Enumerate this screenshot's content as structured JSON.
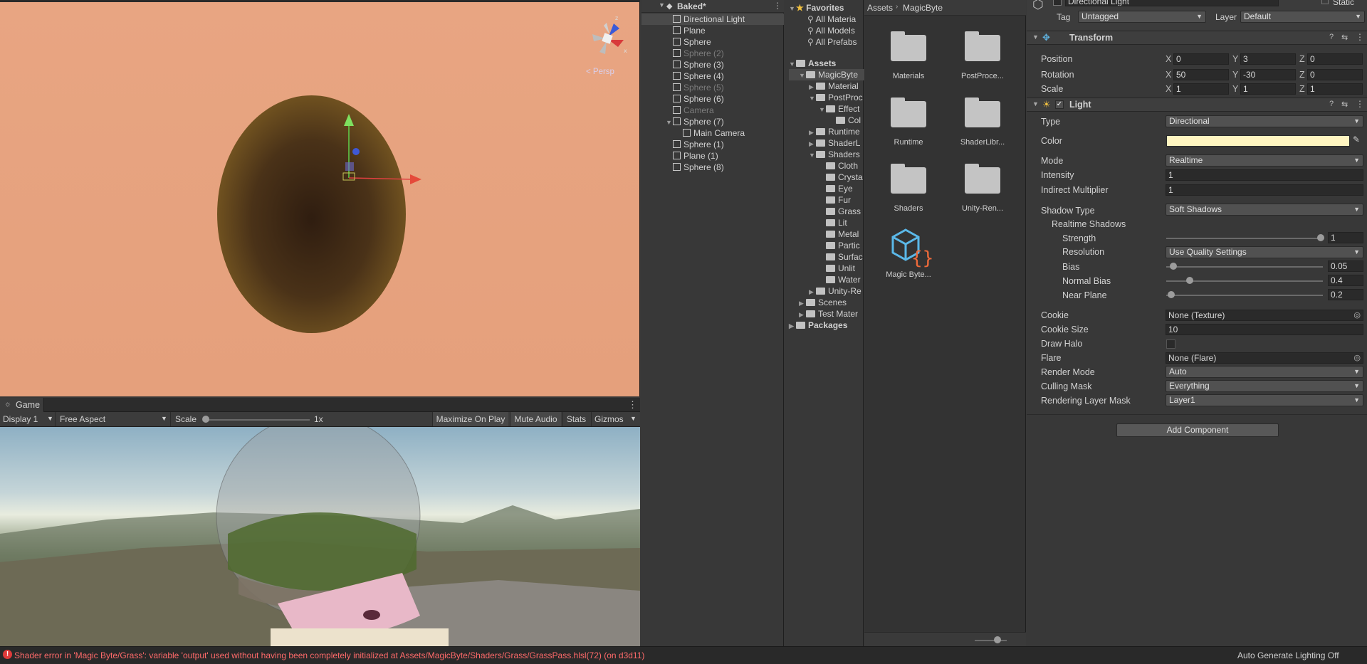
{
  "scene": {
    "persp_label": "< Persp"
  },
  "game": {
    "tab_label": "Game",
    "display": "Display 1",
    "aspect": "Free Aspect",
    "scale_label": "Scale",
    "scale_value": "1x",
    "maximize": "Maximize On Play",
    "mute": "Mute Audio",
    "stats": "Stats",
    "gizmos": "Gizmos"
  },
  "hierarchy": {
    "scene_name": "Baked*",
    "items": [
      {
        "label": "Directional Light",
        "dim": false
      },
      {
        "label": "Plane",
        "dim": false
      },
      {
        "label": "Sphere",
        "dim": false
      },
      {
        "label": "Sphere (2)",
        "dim": true
      },
      {
        "label": "Sphere (3)",
        "dim": false
      },
      {
        "label": "Sphere (4)",
        "dim": false
      },
      {
        "label": "Sphere (5)",
        "dim": true
      },
      {
        "label": "Sphere (6)",
        "dim": false
      },
      {
        "label": "Camera",
        "dim": true
      },
      {
        "label": "Sphere (7)",
        "dim": false
      },
      {
        "label": "Main Camera",
        "dim": false
      },
      {
        "label": "Sphere (1)",
        "dim": false
      },
      {
        "label": "Plane (1)",
        "dim": false
      },
      {
        "label": "Sphere (8)",
        "dim": false
      }
    ]
  },
  "project_tree": {
    "favorites": "Favorites",
    "fav_items": [
      "All Materia",
      "All Models",
      "All Prefabs"
    ],
    "assets": "Assets",
    "items": [
      "MagicByte",
      "Material",
      "PostProc",
      "Effect",
      "Col",
      "Runtime",
      "ShaderL",
      "Shaders",
      "Cloth",
      "Crysta",
      "Eye",
      "Fur",
      "Grass",
      "Lit",
      "Metal",
      "Partic",
      "Surfac",
      "Unlit",
      "Water",
      "Unity-Re",
      "Scenes",
      "Test Mater",
      "Packages"
    ]
  },
  "project_grid": {
    "breadcrumb": [
      "Assets",
      "MagicByte"
    ],
    "items": [
      "Materials",
      "PostProce...",
      "Runtime",
      "ShaderLibr...",
      "Shaders",
      "Unity-Ren...",
      "Magic Byte..."
    ]
  },
  "inspector": {
    "object_name": "Directional Light",
    "static": "Static",
    "tag_label": "Tag",
    "tag_value": "Untagged",
    "layer_label": "Layer",
    "layer_value": "Default",
    "transform": {
      "title": "Transform",
      "position_label": "Position",
      "position": [
        "0",
        "3",
        "0"
      ],
      "rotation_label": "Rotation",
      "rotation": [
        "50",
        "-30",
        "0"
      ],
      "scale_label": "Scale",
      "scale": [
        "1",
        "1",
        "1"
      ]
    },
    "light": {
      "title": "Light",
      "type_label": "Type",
      "type_value": "Directional",
      "color_label": "Color",
      "color": "#fff5c0",
      "mode_label": "Mode",
      "mode_value": "Realtime",
      "intensity_label": "Intensity",
      "intensity_value": "1",
      "indirect_label": "Indirect Multiplier",
      "indirect_value": "1",
      "shadow_type_label": "Shadow Type",
      "shadow_type_value": "Soft Shadows",
      "realtime_shadows_label": "Realtime Shadows",
      "strength_label": "Strength",
      "strength_value": "1",
      "resolution_label": "Resolution",
      "resolution_value": "Use Quality Settings",
      "bias_label": "Bias",
      "bias_value": "0.05",
      "normal_bias_label": "Normal Bias",
      "normal_bias_value": "0.4",
      "near_plane_label": "Near Plane",
      "near_plane_value": "0.2",
      "cookie_label": "Cookie",
      "cookie_value": "None (Texture)",
      "cookie_size_label": "Cookie Size",
      "cookie_size_value": "10",
      "draw_halo_label": "Draw Halo",
      "flare_label": "Flare",
      "flare_value": "None (Flare)",
      "render_mode_label": "Render Mode",
      "render_mode_value": "Auto",
      "culling_mask_label": "Culling Mask",
      "culling_mask_value": "Everything",
      "rendering_layer_label": "Rendering Layer Mask",
      "rendering_layer_value": "Layer1"
    },
    "add_component": "Add Component"
  },
  "status": {
    "error": "Shader error in 'Magic Byte/Grass': variable 'output' used without having been completely initialized at Assets/MagicByte/Shaders/Grass/GrassPass.hlsl(72) (on d3d11)",
    "lighting": "Auto Generate Lighting Off",
    "error_color": "#ff6a6a"
  }
}
